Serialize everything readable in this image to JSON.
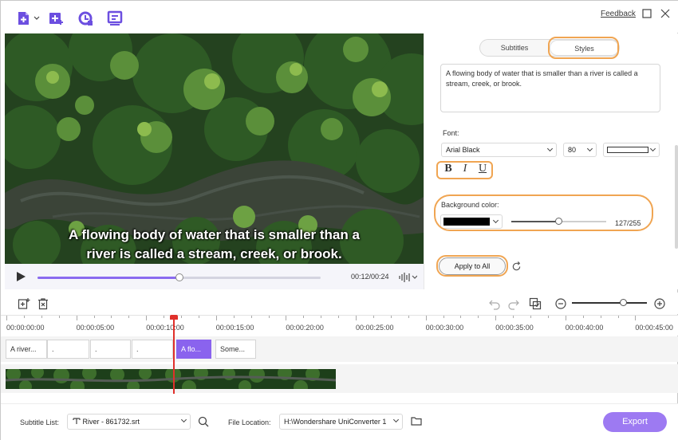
{
  "toolbar": {
    "feedback_label": "Feedback"
  },
  "player": {
    "caption_line1": "A flowing body of water that is smaller than a",
    "caption_line2": "river is called a stream, creek, or brook.",
    "time": "00:12/00:24",
    "progress": 0.5
  },
  "panel": {
    "tabs": [
      {
        "label": "Subtitles",
        "active": false
      },
      {
        "label": "Styles",
        "active": true
      }
    ],
    "subtitle_text": "A flowing body of water that is smaller than a river is called a stream, creek, or brook.",
    "font_label": "Font:",
    "font_family": "Arial Black",
    "font_size": "80",
    "font_color": "#ffffff",
    "format_buttons": [
      "B",
      "I",
      "U"
    ],
    "background_label": "Background color:",
    "background_color": "#000000",
    "opacity_value": "127/255",
    "opacity_fraction": 0.498,
    "apply_label": "Apply to All"
  },
  "timeline": {
    "ruler_labels": [
      "00:00:00:00",
      "00:00:05:00",
      "00:00:10:00",
      "00:00:15:00",
      "00:00:20:00",
      "00:00:25:00",
      "00:00:30:00",
      "00:00:35:00",
      "00:00:40:00",
      "00:00:45:00"
    ],
    "clips": [
      {
        "label": "A river...",
        "selected": false
      },
      {
        "label": ".",
        "selected": false
      },
      {
        "label": ".",
        "selected": false
      },
      {
        "label": ".",
        "selected": false
      },
      {
        "label": "A flo...",
        "selected": true
      },
      {
        "label": "Some...",
        "selected": false
      }
    ],
    "zoom_level": 0.68
  },
  "bottom": {
    "subtitle_list_label": "Subtitle List:",
    "subtitle_file": "River - 861732.srt",
    "file_location_label": "File Location:",
    "file_location": "H:\\Wondershare UniConverter 1",
    "export_label": "Export"
  },
  "colors": {
    "accent": "#8a63ee",
    "highlight": "#f0a552",
    "playhead": "#e0302b"
  }
}
